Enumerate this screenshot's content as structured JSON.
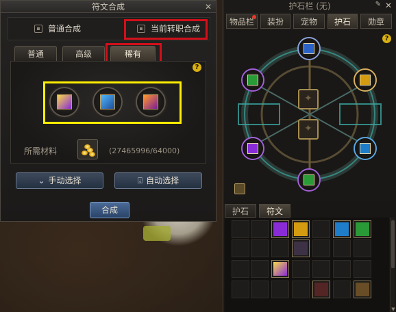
{
  "synth": {
    "title": "符文合成",
    "mode_normal": "普通合成",
    "mode_class": "当前转职合成",
    "tabs": [
      "普通",
      "高级",
      "稀有"
    ],
    "help": "?",
    "material_label": "所需材料",
    "material_count": "(27465996/64000)",
    "manual_select": "手动选择",
    "auto_select": "自动选择",
    "synthesize": "合成"
  },
  "guard": {
    "title": "护石栏 (无)",
    "close": "✕",
    "pin": "✎",
    "tabs": [
      "物品栏",
      "装扮",
      "宠物",
      "护石",
      "勋章"
    ],
    "help": "?",
    "bottom_tabs": [
      "护石",
      "符文"
    ]
  },
  "colors": {
    "rune_purple": "#8a2bd8",
    "rune_blue": "#1f7cc8",
    "rune_gold": "#d49a10",
    "rune_green": "#2a9a36",
    "rune_red": "#c03a10",
    "highlight_red": "#d2101a",
    "highlight_yellow": "#ffee00"
  }
}
